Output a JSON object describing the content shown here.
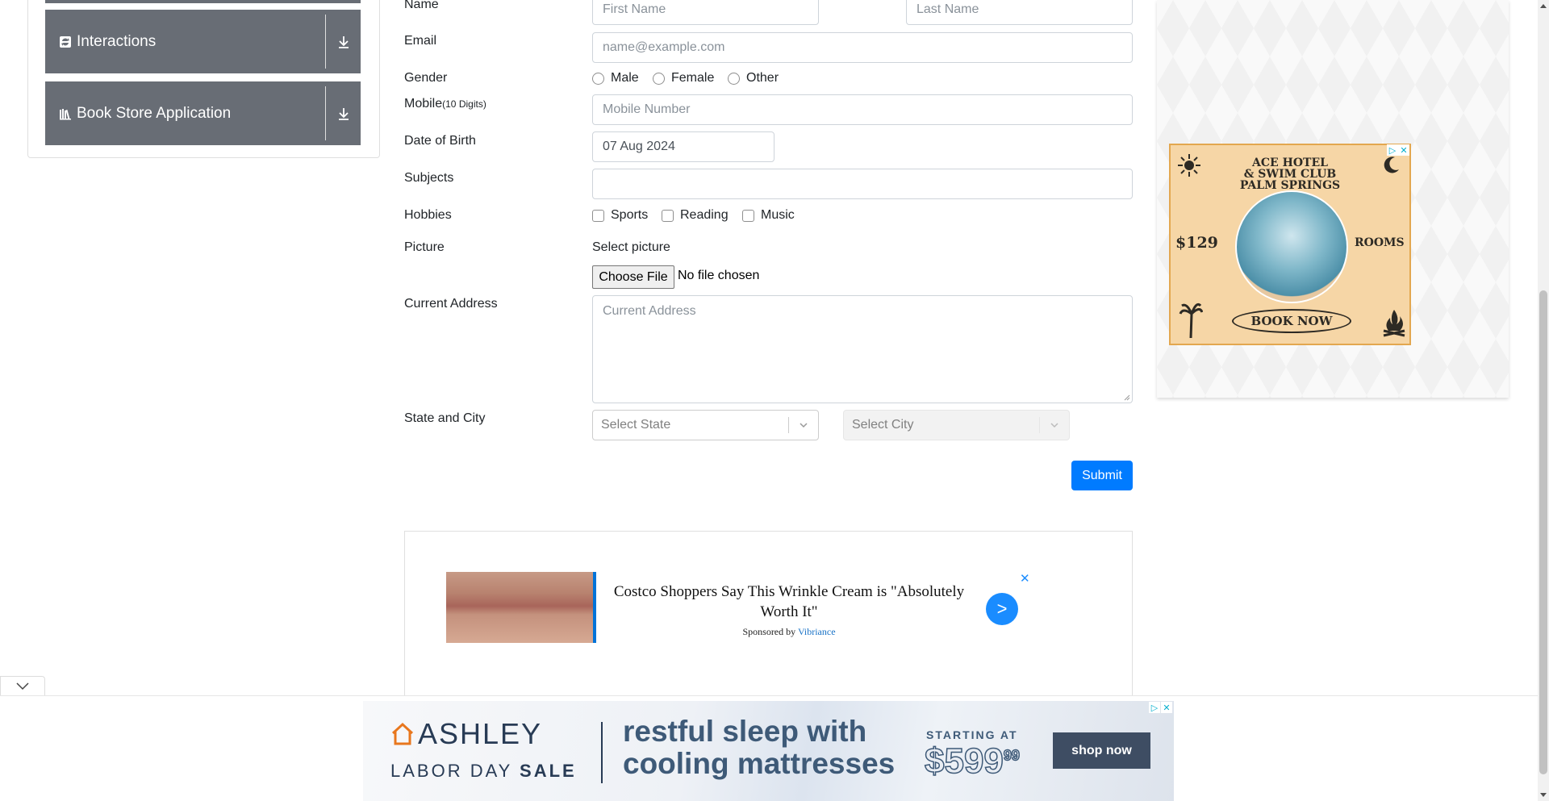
{
  "sidebar": {
    "groups": [
      {
        "label": "Interactions",
        "icon": "interactions-icon"
      },
      {
        "label": "Book Store Application",
        "icon": "book-store-icon"
      }
    ]
  },
  "form": {
    "name_label": "Name",
    "first_name_placeholder": "First Name",
    "last_name_placeholder": "Last Name",
    "email_label": "Email",
    "email_placeholder": "name@example.com",
    "gender_label": "Gender",
    "gender_options": [
      "Male",
      "Female",
      "Other"
    ],
    "mobile_label": "Mobile",
    "mobile_hint": "(10 Digits)",
    "mobile_placeholder": "Mobile Number",
    "dob_label": "Date of Birth",
    "dob_value": "07 Aug 2024",
    "subjects_label": "Subjects",
    "hobbies_label": "Hobbies",
    "hobbies": [
      "Sports",
      "Reading",
      "Music"
    ],
    "picture_label": "Picture",
    "select_picture": "Select picture",
    "choose_file": "Choose File",
    "no_file": "No file chosen",
    "address_label": "Current Address",
    "address_placeholder": "Current Address",
    "state_city_label": "State and City",
    "state_placeholder": "Select State",
    "city_placeholder": "Select City",
    "submit_label": "Submit"
  },
  "ads": {
    "costco": {
      "title": "Costco Shoppers Say This Wrinkle Cream is \"Absolutely Worth It\"",
      "sponsored_prefix": "Sponsored by",
      "sponsor": "Vibriance",
      "go": ">",
      "close": "✕"
    },
    "hotel": {
      "title_line1": "ACE HOTEL",
      "title_line2": "& SWIM CLUB",
      "title_line3": "PALM SPRINGS",
      "price": "$129",
      "rooms": "ROOMS",
      "cta": "BOOK NOW"
    },
    "ashley": {
      "brand": "ASHLEY",
      "sale_prefix": "LABOR DAY",
      "sale": "SALE",
      "headline_1": "restful sleep with",
      "headline_2": "cooling mattresses",
      "starting": "STARTING AT",
      "price": "$599",
      "cents": "99",
      "cta": "shop now"
    }
  },
  "colors": {
    "sidebar_group_bg": "#686d75",
    "primary": "#007bff",
    "ad_accent": "#1a8cff"
  }
}
